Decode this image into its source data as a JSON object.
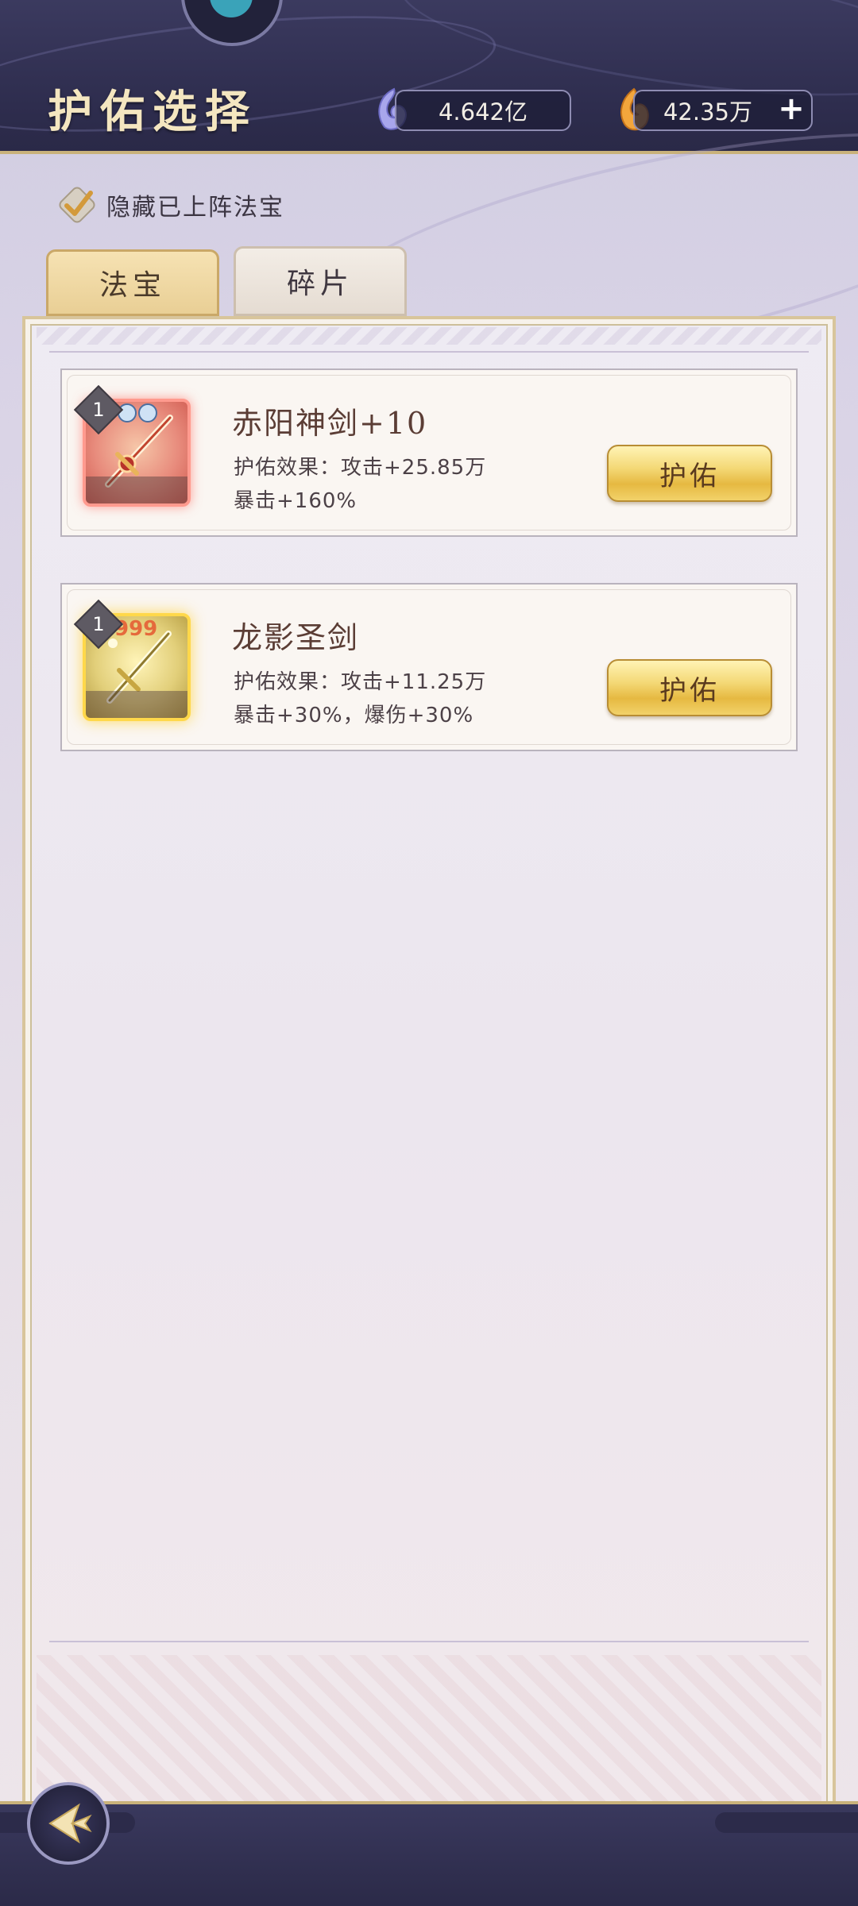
{
  "header": {
    "title": "护佑选择",
    "currency": [
      {
        "icon": "spirit-jade-icon",
        "value": "4.642亿"
      },
      {
        "icon": "flame-essence-icon",
        "value": "42.35万"
      }
    ],
    "plus_label": "+"
  },
  "filter": {
    "hide_label": "隐藏已上阵法宝",
    "checked": true
  },
  "tabs": [
    {
      "label": "法宝",
      "active": true
    },
    {
      "label": "碎片",
      "active": false
    }
  ],
  "items": [
    {
      "level": "1",
      "name": "赤阳神剑+10",
      "effect_line1": "护佑效果：攻击+25.85万",
      "effect_line2": "暴击+160%",
      "button_label": "护佑",
      "rarity_color": "#e88c7d",
      "icon": "crimson-sword-icon"
    },
    {
      "level": "1",
      "name": "龙影圣剑",
      "effect_line1": "护佑效果：攻击+11.25万",
      "effect_line2": "暴击+30%，爆伤+30%",
      "button_label": "护佑",
      "rarity_color": "#ffd84a",
      "icon": "golden-sword-icon"
    }
  ],
  "colors": {
    "header_bg": "#2e2d4e",
    "gold_accent": "#c9b27a",
    "button_gold": "#f4d977"
  }
}
